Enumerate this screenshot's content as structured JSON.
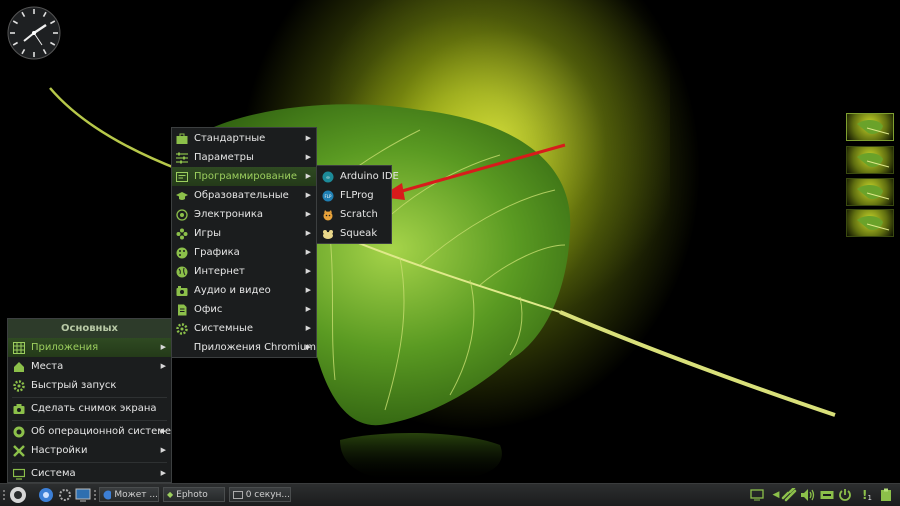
{
  "main_menu": {
    "header": "Основных",
    "items": [
      {
        "label": "Приложения",
        "icon": "grid-icon",
        "submenu": true,
        "highlighted": true
      },
      {
        "label": "Места",
        "icon": "home-icon",
        "submenu": true
      },
      {
        "label": "Быстрый запуск",
        "icon": "gear-icon",
        "submenu": false
      },
      {
        "label": "Сделать снимок экрана",
        "icon": "camera-icon",
        "submenu": false
      },
      {
        "label": "Об операционной системе",
        "icon": "info-icon",
        "submenu": true
      },
      {
        "label": "Настройки",
        "icon": "tools-icon",
        "submenu": true
      },
      {
        "label": "Система",
        "icon": "monitor-icon",
        "submenu": true
      }
    ]
  },
  "apps_menu": {
    "items": [
      {
        "label": "Стандартные",
        "icon": "briefcase-icon"
      },
      {
        "label": "Параметры",
        "icon": "sliders-icon"
      },
      {
        "label": "Программирование",
        "icon": "code-icon",
        "highlighted": true
      },
      {
        "label": "Образовательные",
        "icon": "graduation-cap-icon"
      },
      {
        "label": "Электроника",
        "icon": "chip-icon"
      },
      {
        "label": "Игры",
        "icon": "gamepad-icon"
      },
      {
        "label": "Графика",
        "icon": "palette-icon"
      },
      {
        "label": "Интернет",
        "icon": "globe-icon"
      },
      {
        "label": "Аудио и видео",
        "icon": "audio-icon"
      },
      {
        "label": "Офис",
        "icon": "document-icon"
      },
      {
        "label": "Системные",
        "icon": "gear-icon"
      },
      {
        "label": "Приложения Chromium",
        "icon": "none"
      }
    ]
  },
  "programming_menu": {
    "items": [
      {
        "label": "Arduino IDE",
        "icon": "arduino-icon"
      },
      {
        "label": "FLProg",
        "icon": "flprog-icon"
      },
      {
        "label": "Scratch",
        "icon": "scratch-icon"
      },
      {
        "label": "Squeak",
        "icon": "squeak-icon"
      }
    ]
  },
  "taskbar": {
    "tasks": [
      {
        "label": "Может ...",
        "icon": "chromium-icon"
      },
      {
        "label": "Ephoto",
        "icon": "image-viewer-icon"
      },
      {
        "label": "0 секун...",
        "icon": "recorder-icon"
      }
    ],
    "tray_badge": "1"
  },
  "colors": {
    "accent_green": "#9ccf5e",
    "highlight_bg": "#2f4a22",
    "menu_bg": "#1b1d1e",
    "arrow_red": "#d81b1b"
  }
}
